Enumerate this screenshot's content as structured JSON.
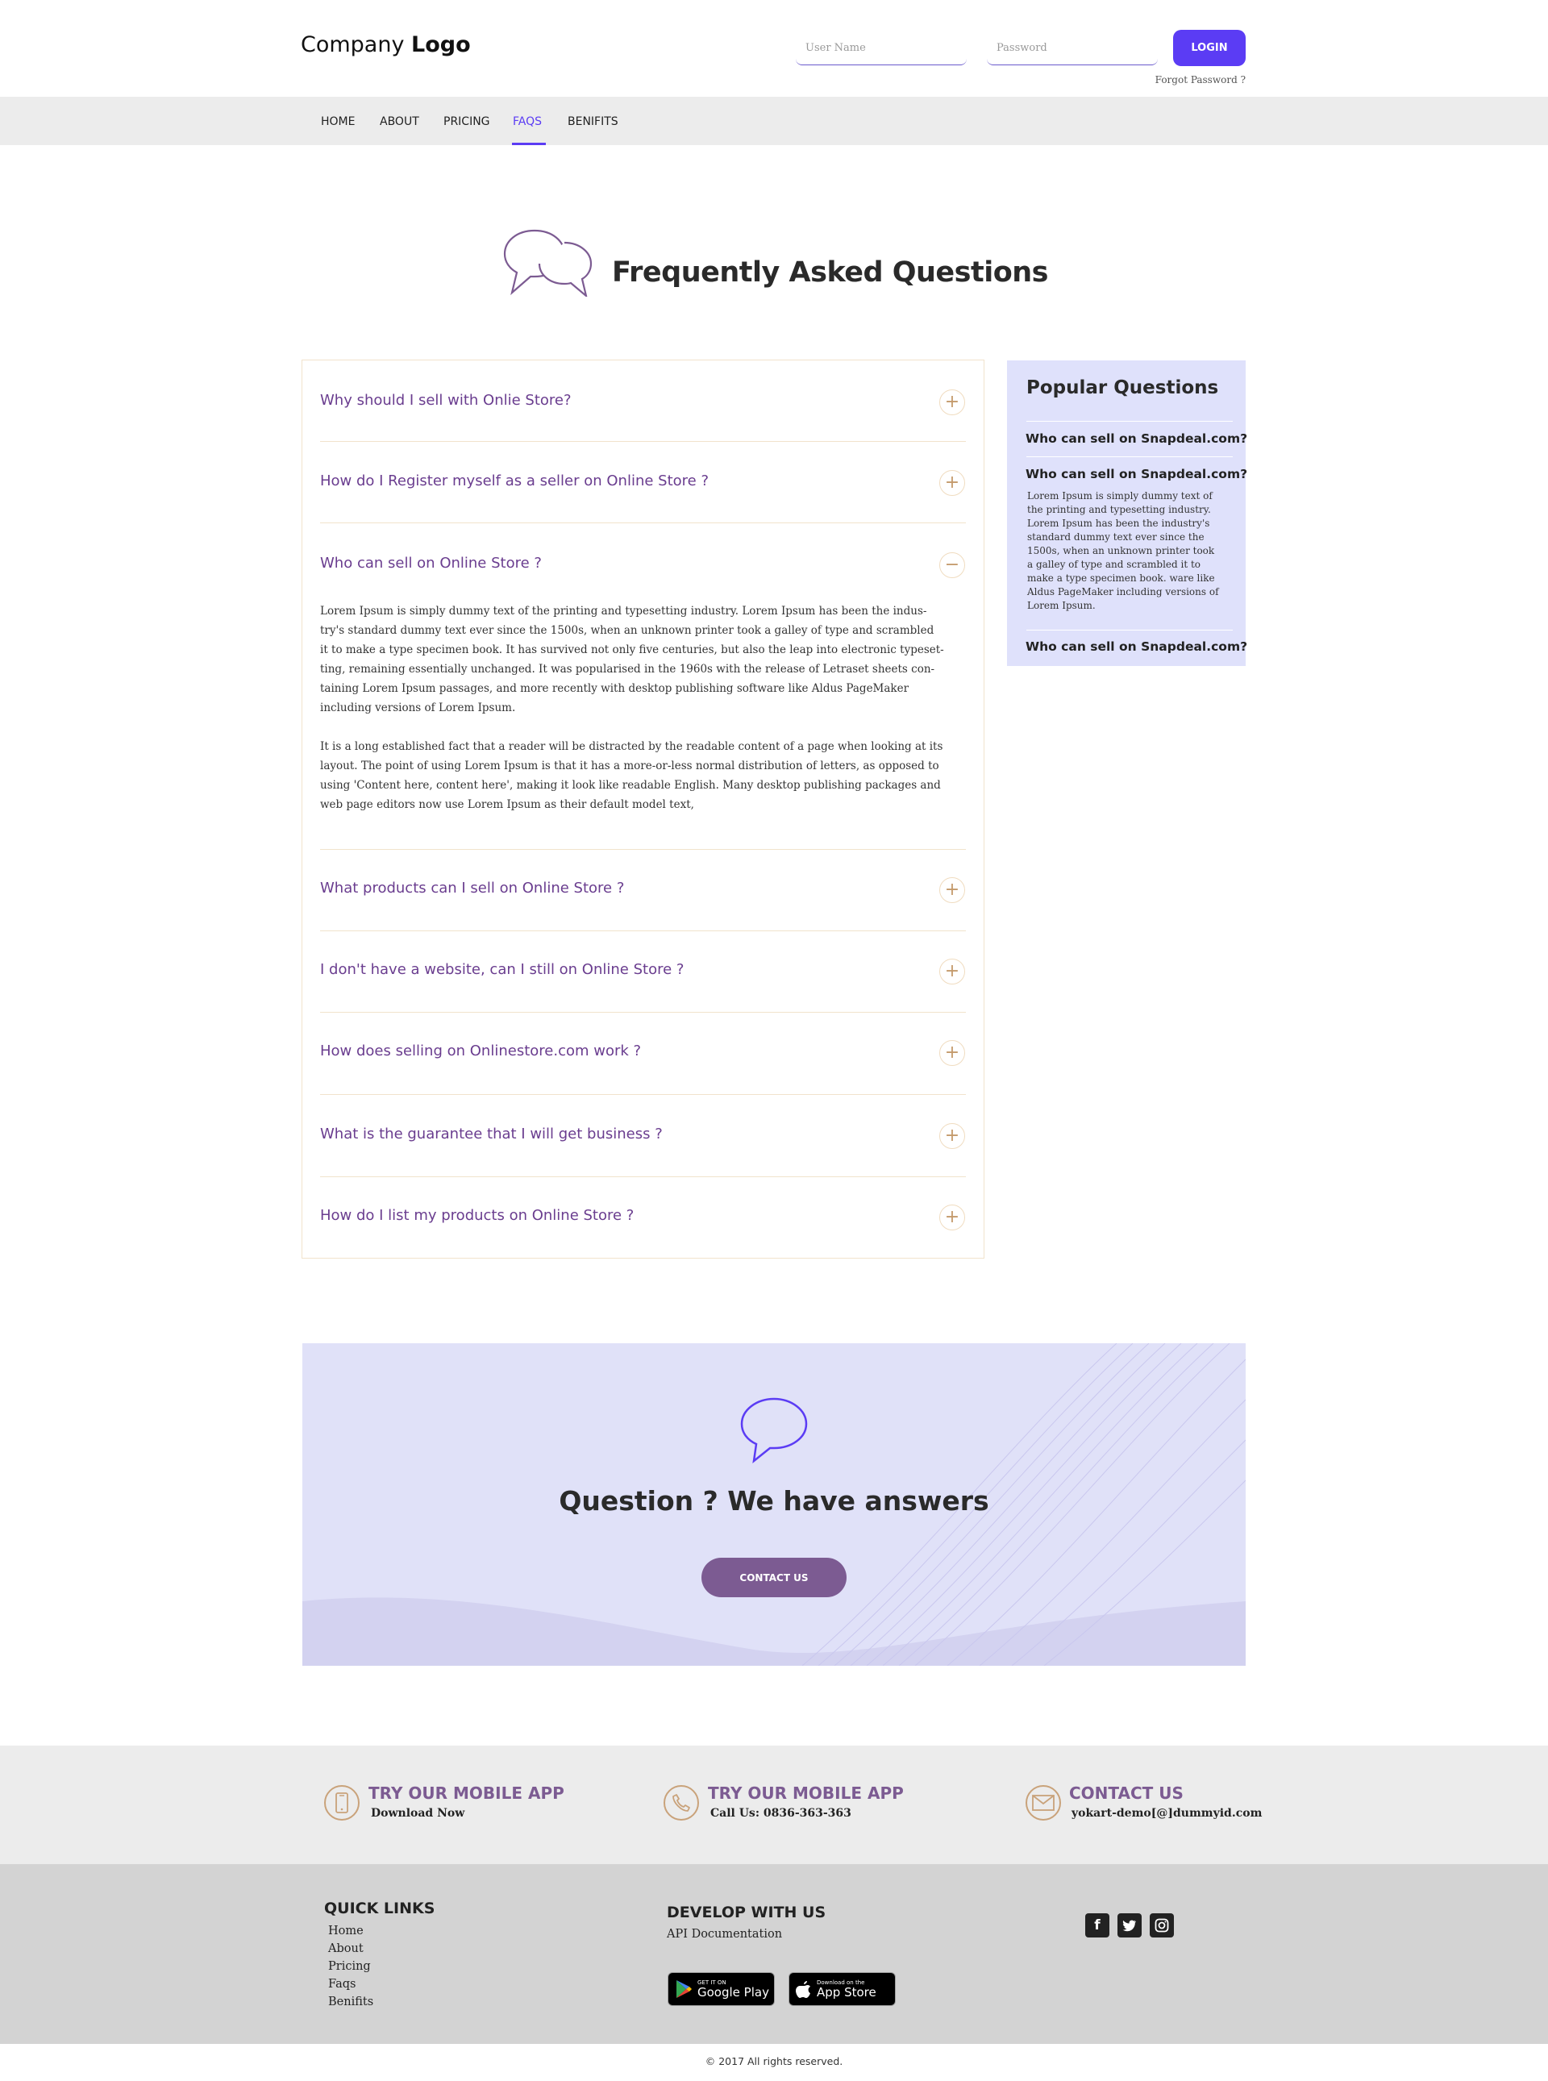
{
  "header": {
    "logo_regular": "Company ",
    "logo_bold": "Logo",
    "username_placeholder": "User Name",
    "password_placeholder": "Password",
    "login_label": "LOGIN",
    "forgot_label": "Forgot Password ?"
  },
  "nav": {
    "items": [
      "HOME",
      "ABOUT",
      "PRICING",
      "FAQS",
      "BENIFITS"
    ],
    "active": "FAQS",
    "accent": "#5b3cf4"
  },
  "faq": {
    "title": "Frequently Asked Questions",
    "questions": [
      {
        "label": "Why should I sell with Onlie Store?",
        "state": "+"
      },
      {
        "label": "How do I Register myself as a seller on Online Store ?",
        "state": "+"
      },
      {
        "label": "Who can sell on Online Store ?",
        "state": "−"
      },
      {
        "label": "What products can I sell on Online Store ?",
        "state": "+"
      },
      {
        "label": "I don't have a website, can I still on Online Store ?",
        "state": "+"
      },
      {
        "label": "How does selling on Onlinestore.com work ?",
        "state": "+"
      },
      {
        "label": "What is the guarantee that I will get business ?",
        "state": "+"
      },
      {
        "label": "How do I list my products on Online Store ?",
        "state": "+"
      }
    ],
    "answer_lines_1": [
      "Lorem Ipsum is simply dummy text of the printing and typesetting industry. Lorem Ipsum has been the indus-",
      "try's standard dummy text ever since the 1500s, when an unknown printer took a galley of type and scrambled",
      "it to make a type specimen book. It has survived not only five centuries, but also the leap into electronic typeset-",
      "ting, remaining essentially unchanged. It was popularised in the 1960s with the release of Letraset sheets con-",
      "taining Lorem Ipsum passages, and more recently with desktop publishing software like Aldus PageMaker",
      "including versions of Lorem Ipsum."
    ],
    "answer_lines_2": [
      "It is a long established fact that a reader will be distracted by the readable content of a page when looking at its",
      "layout. The point of using Lorem Ipsum is that it has a more-or-less normal distribution of letters, as opposed to",
      "using 'Content here, content here', making it look like readable English. Many desktop publishing packages and",
      "web page editors now use Lorem Ipsum as their default model text,"
    ],
    "title_color": "#6a3d8f"
  },
  "popular": {
    "title": "Popular Questions",
    "questions": [
      "Who can sell on Snapdeal.com?",
      "Who can sell on Snapdeal.com?",
      "Who can sell on Snapdeal.com?"
    ],
    "answer_lines": [
      "Lorem Ipsum is simply dummy text of",
      "the printing and typesetting industry.",
      "Lorem Ipsum has been the industry's",
      "standard dummy text ever since the",
      "1500s, when an unknown printer took",
      "a galley of type and scrambled it to",
      "make a type specimen book. ware like",
      "Aldus PageMaker including versions of",
      "Lorem Ipsum."
    ],
    "bg": "#dfe1fb"
  },
  "banner": {
    "title": "Question ? We have answers",
    "button": "CONTACT US",
    "bg": "#e0e1f8"
  },
  "info": [
    {
      "title": "TRY OUR MOBILE APP",
      "sub": "Download Now",
      "icon": "mobile-phone-icon"
    },
    {
      "title": "TRY OUR MOBILE APP",
      "sub": "Call Us: 0836-363-363",
      "icon": "phone-icon"
    },
    {
      "title": "CONTACT US",
      "sub": "yokart-demo[@]dummyid.com",
      "icon": "envelope-icon"
    }
  ],
  "footer": {
    "quick_links_title": "QUICK LINKS",
    "quick_links": [
      "Home",
      "About",
      "Pricing",
      "Faqs",
      "Benifits"
    ],
    "develop_title": "DEVELOP WITH US",
    "develop_link": "API Documentation",
    "google_small": "GET IT ON",
    "google_big": "Google Play",
    "apple_small": "Download on the",
    "apple_big": "App Store",
    "social": [
      "facebook-icon",
      "twitter-icon",
      "instagram-icon"
    ],
    "copyright": "© 2017 All rights reserved."
  }
}
